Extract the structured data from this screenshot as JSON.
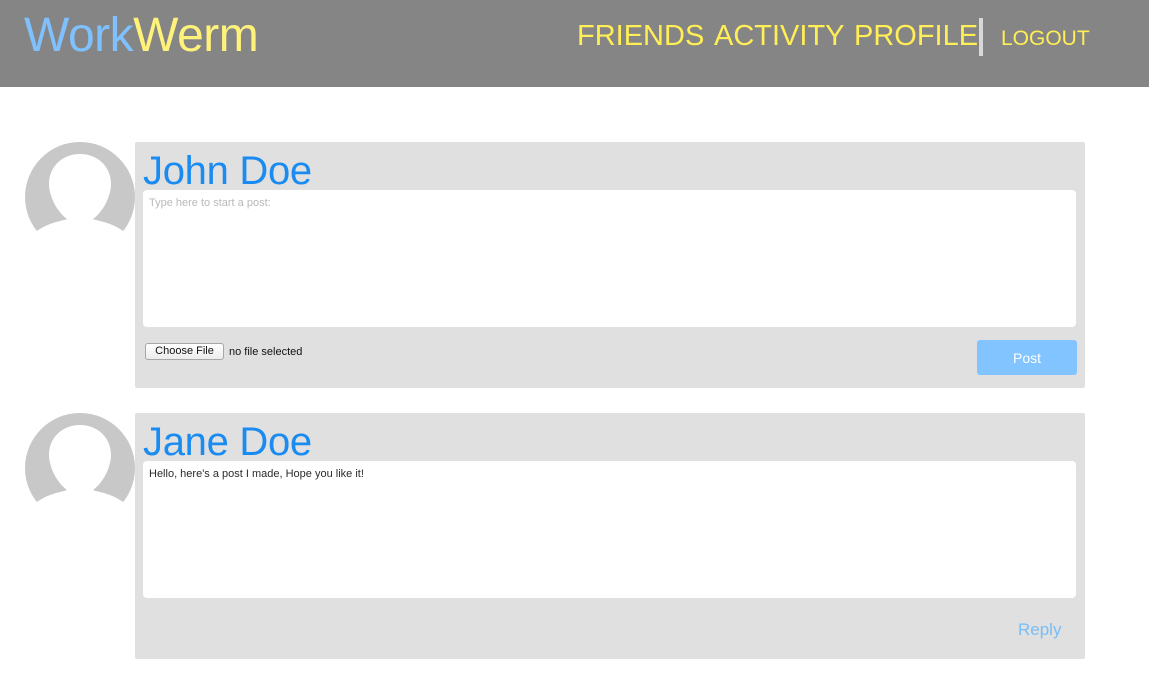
{
  "header": {
    "brand_part1": "Work",
    "brand_part2": "Werm",
    "nav": {
      "friends": "FRIENDS",
      "activity": "ACTIVITY",
      "profile": "PROFILE",
      "logout": "LOGOUT"
    }
  },
  "composer": {
    "author": "John Doe",
    "placeholder": "Type here to start a post:",
    "choose_file_label": "Choose File",
    "file_status": "no file selected",
    "post_label": "Post",
    "avatar_icon": "user-avatar-icon"
  },
  "posts": [
    {
      "author": "Jane Doe",
      "body": "Hello, here's a post I made, Hope you like it!",
      "reply_label": "Reply",
      "avatar_icon": "user-avatar-icon"
    }
  ],
  "colors": {
    "header_bg": "#858585",
    "brand_blue": "#7fc0ff",
    "brand_yellow": "#fff27a",
    "nav_yellow": "#ffee55",
    "author_blue": "#1a8bf0",
    "card_bg": "#e0e0e0",
    "post_button": "#82c4ff",
    "reply_link": "#78bdfa",
    "avatar_gray": "#c8c8c8"
  }
}
